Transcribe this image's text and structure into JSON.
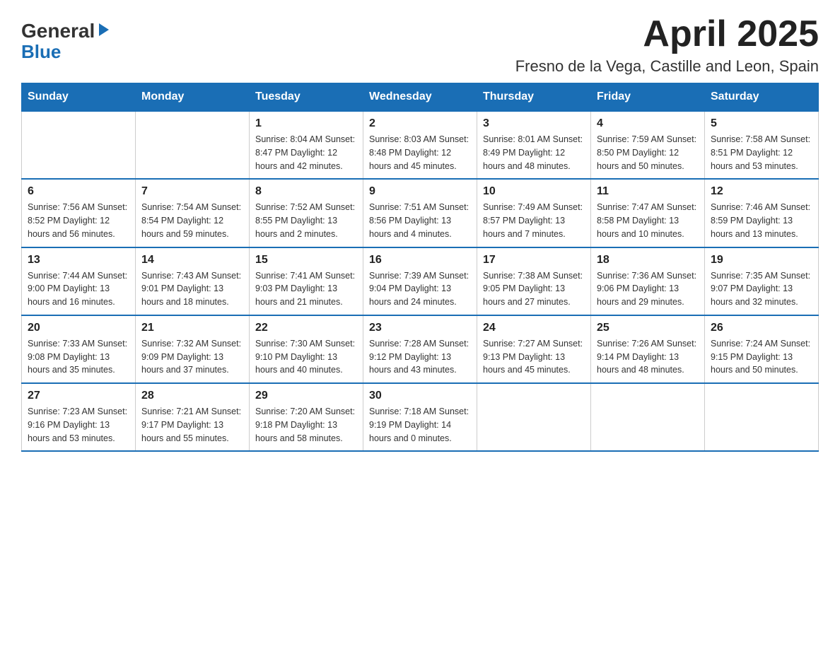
{
  "header": {
    "logo_general": "General",
    "logo_blue": "Blue",
    "title": "April 2025",
    "subtitle": "Fresno de la Vega, Castille and Leon, Spain"
  },
  "days_of_week": [
    "Sunday",
    "Monday",
    "Tuesday",
    "Wednesday",
    "Thursday",
    "Friday",
    "Saturday"
  ],
  "weeks": [
    [
      {
        "day": "",
        "info": ""
      },
      {
        "day": "",
        "info": ""
      },
      {
        "day": "1",
        "info": "Sunrise: 8:04 AM\nSunset: 8:47 PM\nDaylight: 12 hours\nand 42 minutes."
      },
      {
        "day": "2",
        "info": "Sunrise: 8:03 AM\nSunset: 8:48 PM\nDaylight: 12 hours\nand 45 minutes."
      },
      {
        "day": "3",
        "info": "Sunrise: 8:01 AM\nSunset: 8:49 PM\nDaylight: 12 hours\nand 48 minutes."
      },
      {
        "day": "4",
        "info": "Sunrise: 7:59 AM\nSunset: 8:50 PM\nDaylight: 12 hours\nand 50 minutes."
      },
      {
        "day": "5",
        "info": "Sunrise: 7:58 AM\nSunset: 8:51 PM\nDaylight: 12 hours\nand 53 minutes."
      }
    ],
    [
      {
        "day": "6",
        "info": "Sunrise: 7:56 AM\nSunset: 8:52 PM\nDaylight: 12 hours\nand 56 minutes."
      },
      {
        "day": "7",
        "info": "Sunrise: 7:54 AM\nSunset: 8:54 PM\nDaylight: 12 hours\nand 59 minutes."
      },
      {
        "day": "8",
        "info": "Sunrise: 7:52 AM\nSunset: 8:55 PM\nDaylight: 13 hours\nand 2 minutes."
      },
      {
        "day": "9",
        "info": "Sunrise: 7:51 AM\nSunset: 8:56 PM\nDaylight: 13 hours\nand 4 minutes."
      },
      {
        "day": "10",
        "info": "Sunrise: 7:49 AM\nSunset: 8:57 PM\nDaylight: 13 hours\nand 7 minutes."
      },
      {
        "day": "11",
        "info": "Sunrise: 7:47 AM\nSunset: 8:58 PM\nDaylight: 13 hours\nand 10 minutes."
      },
      {
        "day": "12",
        "info": "Sunrise: 7:46 AM\nSunset: 8:59 PM\nDaylight: 13 hours\nand 13 minutes."
      }
    ],
    [
      {
        "day": "13",
        "info": "Sunrise: 7:44 AM\nSunset: 9:00 PM\nDaylight: 13 hours\nand 16 minutes."
      },
      {
        "day": "14",
        "info": "Sunrise: 7:43 AM\nSunset: 9:01 PM\nDaylight: 13 hours\nand 18 minutes."
      },
      {
        "day": "15",
        "info": "Sunrise: 7:41 AM\nSunset: 9:03 PM\nDaylight: 13 hours\nand 21 minutes."
      },
      {
        "day": "16",
        "info": "Sunrise: 7:39 AM\nSunset: 9:04 PM\nDaylight: 13 hours\nand 24 minutes."
      },
      {
        "day": "17",
        "info": "Sunrise: 7:38 AM\nSunset: 9:05 PM\nDaylight: 13 hours\nand 27 minutes."
      },
      {
        "day": "18",
        "info": "Sunrise: 7:36 AM\nSunset: 9:06 PM\nDaylight: 13 hours\nand 29 minutes."
      },
      {
        "day": "19",
        "info": "Sunrise: 7:35 AM\nSunset: 9:07 PM\nDaylight: 13 hours\nand 32 minutes."
      }
    ],
    [
      {
        "day": "20",
        "info": "Sunrise: 7:33 AM\nSunset: 9:08 PM\nDaylight: 13 hours\nand 35 minutes."
      },
      {
        "day": "21",
        "info": "Sunrise: 7:32 AM\nSunset: 9:09 PM\nDaylight: 13 hours\nand 37 minutes."
      },
      {
        "day": "22",
        "info": "Sunrise: 7:30 AM\nSunset: 9:10 PM\nDaylight: 13 hours\nand 40 minutes."
      },
      {
        "day": "23",
        "info": "Sunrise: 7:28 AM\nSunset: 9:12 PM\nDaylight: 13 hours\nand 43 minutes."
      },
      {
        "day": "24",
        "info": "Sunrise: 7:27 AM\nSunset: 9:13 PM\nDaylight: 13 hours\nand 45 minutes."
      },
      {
        "day": "25",
        "info": "Sunrise: 7:26 AM\nSunset: 9:14 PM\nDaylight: 13 hours\nand 48 minutes."
      },
      {
        "day": "26",
        "info": "Sunrise: 7:24 AM\nSunset: 9:15 PM\nDaylight: 13 hours\nand 50 minutes."
      }
    ],
    [
      {
        "day": "27",
        "info": "Sunrise: 7:23 AM\nSunset: 9:16 PM\nDaylight: 13 hours\nand 53 minutes."
      },
      {
        "day": "28",
        "info": "Sunrise: 7:21 AM\nSunset: 9:17 PM\nDaylight: 13 hours\nand 55 minutes."
      },
      {
        "day": "29",
        "info": "Sunrise: 7:20 AM\nSunset: 9:18 PM\nDaylight: 13 hours\nand 58 minutes."
      },
      {
        "day": "30",
        "info": "Sunrise: 7:18 AM\nSunset: 9:19 PM\nDaylight: 14 hours\nand 0 minutes."
      },
      {
        "day": "",
        "info": ""
      },
      {
        "day": "",
        "info": ""
      },
      {
        "day": "",
        "info": ""
      }
    ]
  ]
}
